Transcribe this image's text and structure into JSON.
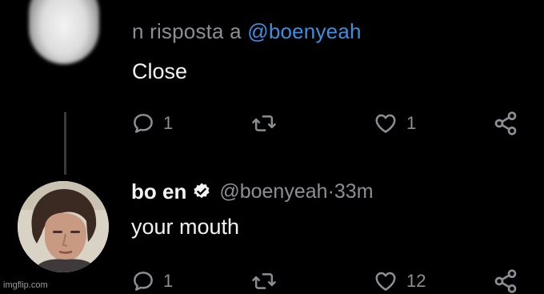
{
  "parent_tweet": {
    "reply_prefix": "n risposta a ",
    "reply_handle": "@boenyeah",
    "text": "Close",
    "reply_count": "1",
    "like_count": "1"
  },
  "reply_tweet": {
    "display_name": "bo en",
    "handle": "@boenyeah",
    "separator": " · ",
    "time": "33m",
    "text": "your mouth",
    "reply_count": "1",
    "like_count": "12"
  },
  "watermark": "imgflip.com",
  "colors": {
    "background": "#000000",
    "text_primary": "#f2f2f2",
    "text_secondary": "#8b8f94",
    "link": "#3b8fe0"
  },
  "icons": {
    "reply": "reply-bubble-icon",
    "retweet": "retweet-icon",
    "like": "heart-icon",
    "share": "share-icon",
    "verified": "verified-badge-icon"
  }
}
